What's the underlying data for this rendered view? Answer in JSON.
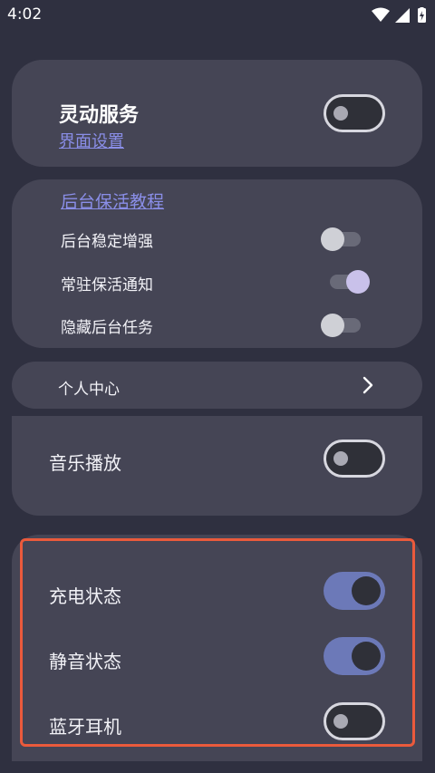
{
  "status": {
    "time": "4:02",
    "icons": [
      "wifi-icon",
      "cellular-signal-icon",
      "battery-charging-icon"
    ]
  },
  "service_card": {
    "title": "灵动服务",
    "link": "界面设置",
    "toggle_on": false
  },
  "background_card": {
    "link": "后台保活教程",
    "items": [
      {
        "label": "后台稳定增强",
        "on": false
      },
      {
        "label": "常驻保活通知",
        "on": true
      },
      {
        "label": "隐藏后台任务",
        "on": false
      }
    ]
  },
  "personal_center": {
    "label": "个人中心",
    "icon": "chevron-right-icon"
  },
  "music_card": {
    "label": "音乐播放",
    "toggle_on": false
  },
  "status_card": {
    "items": [
      {
        "label": "充电状态",
        "on": true
      },
      {
        "label": "静音状态",
        "on": true
      },
      {
        "label": "蓝牙耳机",
        "on": false
      }
    ]
  },
  "colors": {
    "background": "#2f3040",
    "card": "#454555",
    "accent": "#6c79b8",
    "link": "#8a8ee8",
    "highlight_border": "#ea5a3c"
  }
}
